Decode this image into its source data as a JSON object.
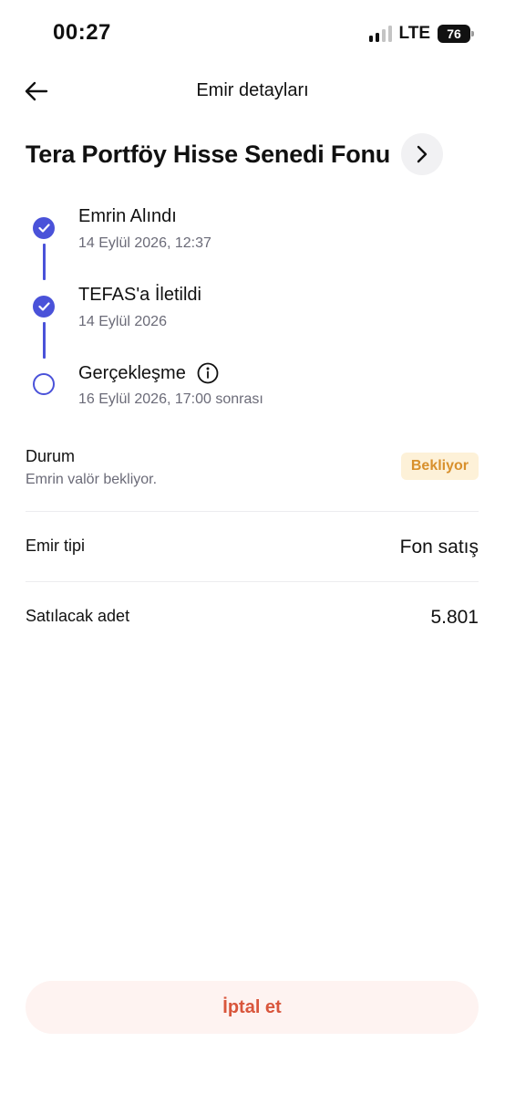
{
  "status_bar": {
    "time": "00:27",
    "network": "LTE",
    "battery": "76"
  },
  "header": {
    "title": "Emir detayları"
  },
  "fund": {
    "name": "Tera Portföy Hisse Senedi Fonu"
  },
  "timeline": {
    "steps": [
      {
        "title": "Emrin Alındı",
        "date": "14 Eylül 2026, 12:37",
        "state": "done"
      },
      {
        "title": "TEFAS'a İletildi",
        "date": "14 Eylül 2026",
        "state": "done"
      },
      {
        "title": "Gerçekleşme",
        "date": "16 Eylül 2026, 17:00 sonrası",
        "state": "pending"
      }
    ]
  },
  "details": {
    "status_label": "Durum",
    "status_sub": "Emrin valör bekliyor.",
    "status_badge": "Bekliyor",
    "order_type_label": "Emir tipi",
    "order_type_value": "Fon satış",
    "quantity_label": "Satılacak adet",
    "quantity_value": "5.801"
  },
  "actions": {
    "cancel_label": "İptal et"
  },
  "colors": {
    "accent": "#4a52d9",
    "badge_bg": "#fdf1d8",
    "badge_text": "#d8902c",
    "cancel_bg": "#fef3f1",
    "cancel_text": "#d9563c"
  }
}
